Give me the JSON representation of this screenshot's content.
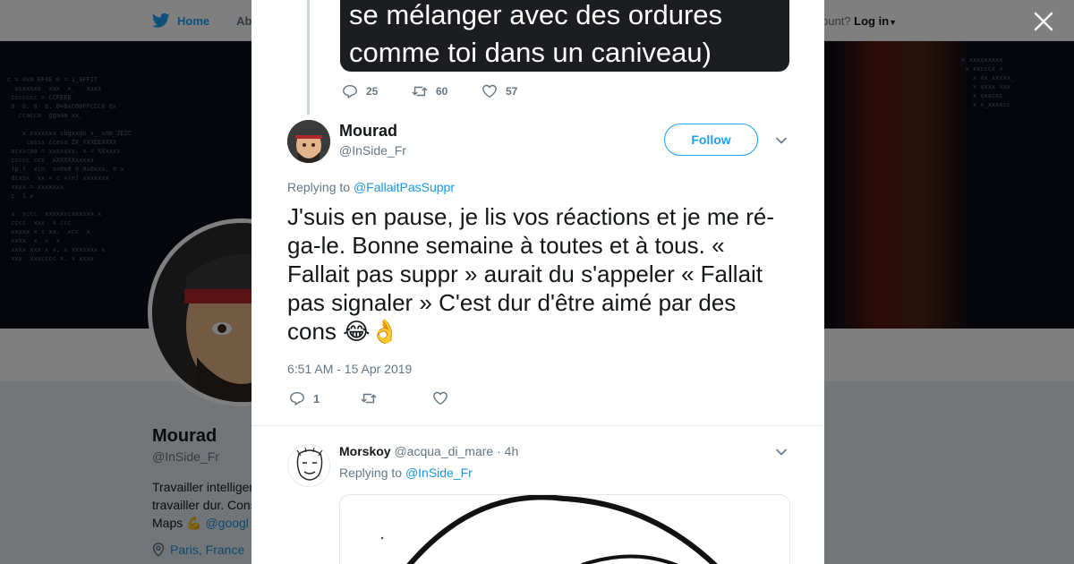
{
  "topbar": {
    "home_label": "Home",
    "about_label": "Abo",
    "account_prompt": "ccount?",
    "login_label": "Log in"
  },
  "background_profile": {
    "name": "Mourad",
    "handle": "@InSide_Fr",
    "bio_line1": "Travailler intelligen",
    "bio_line2": "travailler dur. Cons",
    "bio_line3_text": "Maps",
    "bio_line3_link": "@googl",
    "location": "Paris, France"
  },
  "previous_tweet": {
    "media_line1": "se mélanger avec des ordures",
    "media_line2": "comme toi dans un caniveau)",
    "replies": "25",
    "retweets": "60",
    "likes": "57"
  },
  "main_tweet": {
    "author_name": "Mourad",
    "author_handle": "@InSide_Fr",
    "follow_label": "Follow",
    "replying_prefix": "Replying to",
    "replying_handle": "@FallaitPasSuppr",
    "text": "J'suis en pause, je lis vos réactions et je me ré-ga-le. Bonne semaine à toutes et à tous. « Fallait pas suppr » aurait du s'appeler « Fallait pas signaler » C'est dur d'être aimé par des cons 😂👌",
    "timestamp": "6:51 AM - 15 Apr 2019",
    "replies": "1"
  },
  "reply_tweet": {
    "author_name": "Morskoy",
    "author_handle": "@acqua_di_mare",
    "separator": "·",
    "age": "4h",
    "replying_prefix": "Replying to",
    "replying_handle": "@InSide_Fr"
  },
  "colors": {
    "accent": "#1da1f2",
    "link": "#1b95e0",
    "muted": "#657786",
    "text": "#14171a"
  }
}
